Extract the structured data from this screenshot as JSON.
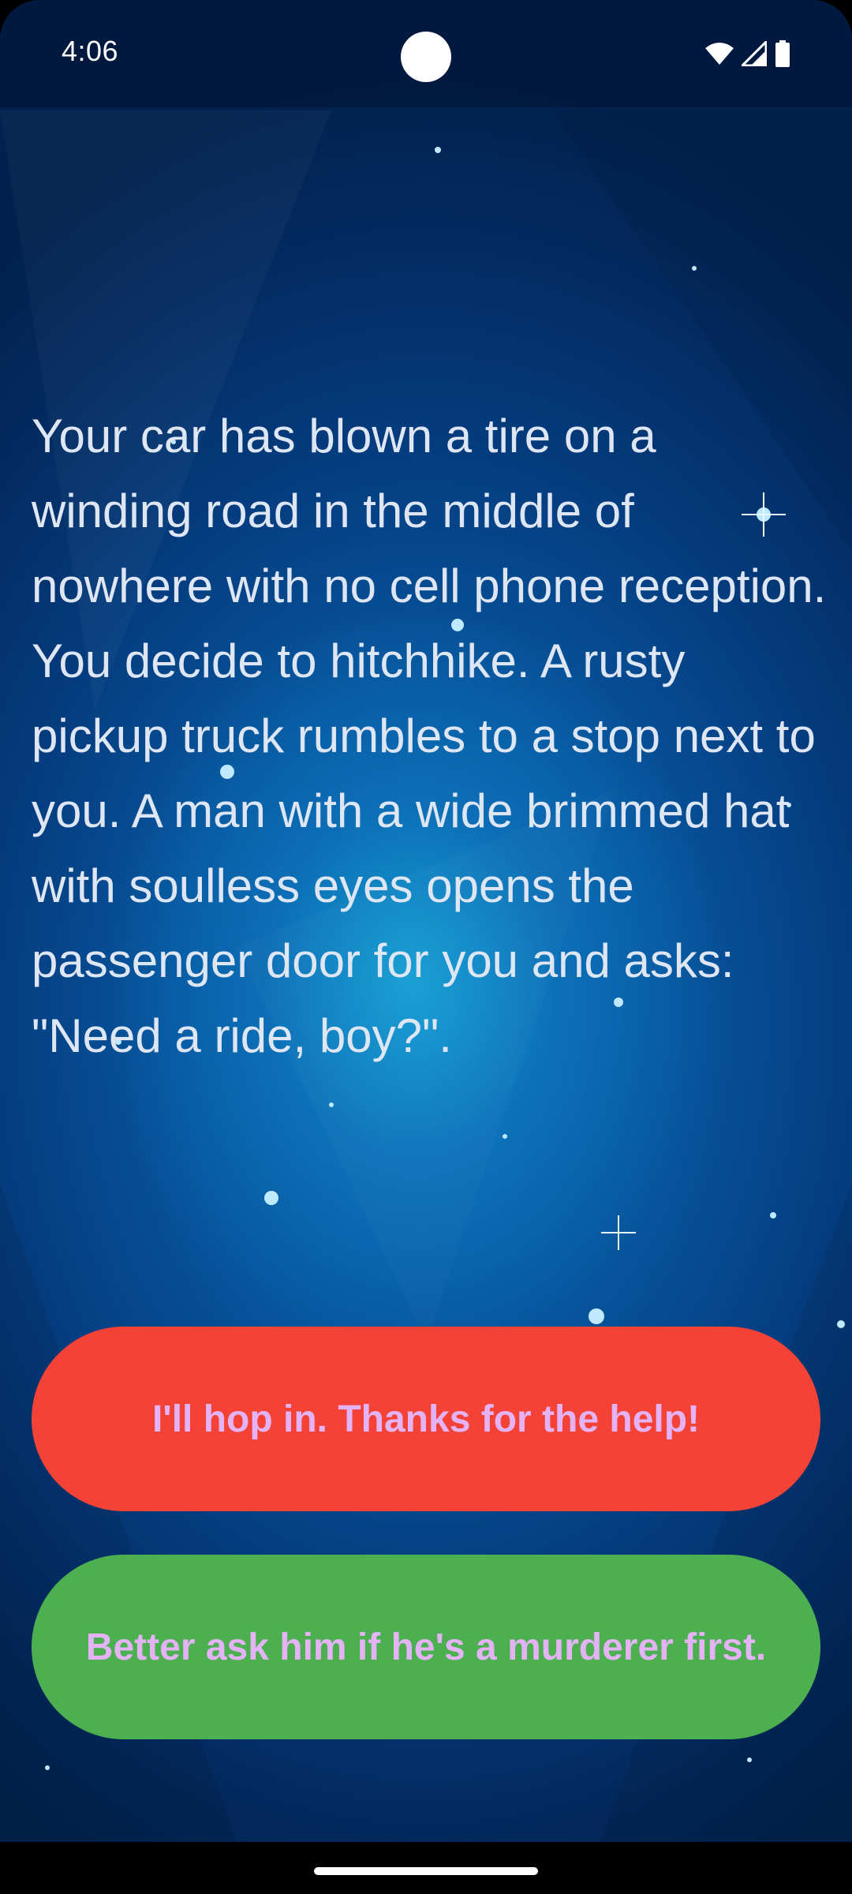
{
  "status_bar": {
    "time": "4:06",
    "icons": [
      "wifi-icon",
      "cell-signal-icon",
      "battery-icon"
    ]
  },
  "story": {
    "text": "Your car has blown a tire on a winding road in the middle of nowhere with no cell phone reception. You decide to hitchhike. A rusty pickup truck rumbles to a stop next to you. A man with a wide brimmed hat with soulless eyes opens the passenger door for you and asks: \"Need a ride, boy?\"."
  },
  "choices": [
    {
      "label": "I'll hop in. Thanks for the help!",
      "color": "#f44336"
    },
    {
      "label": "Better ask him if he's a murderer first.",
      "color": "#4caf50"
    }
  ],
  "colors": {
    "choice_text": "#e3b3f6",
    "story_text": "#dfe6f3",
    "background": "#0a5fa8"
  }
}
